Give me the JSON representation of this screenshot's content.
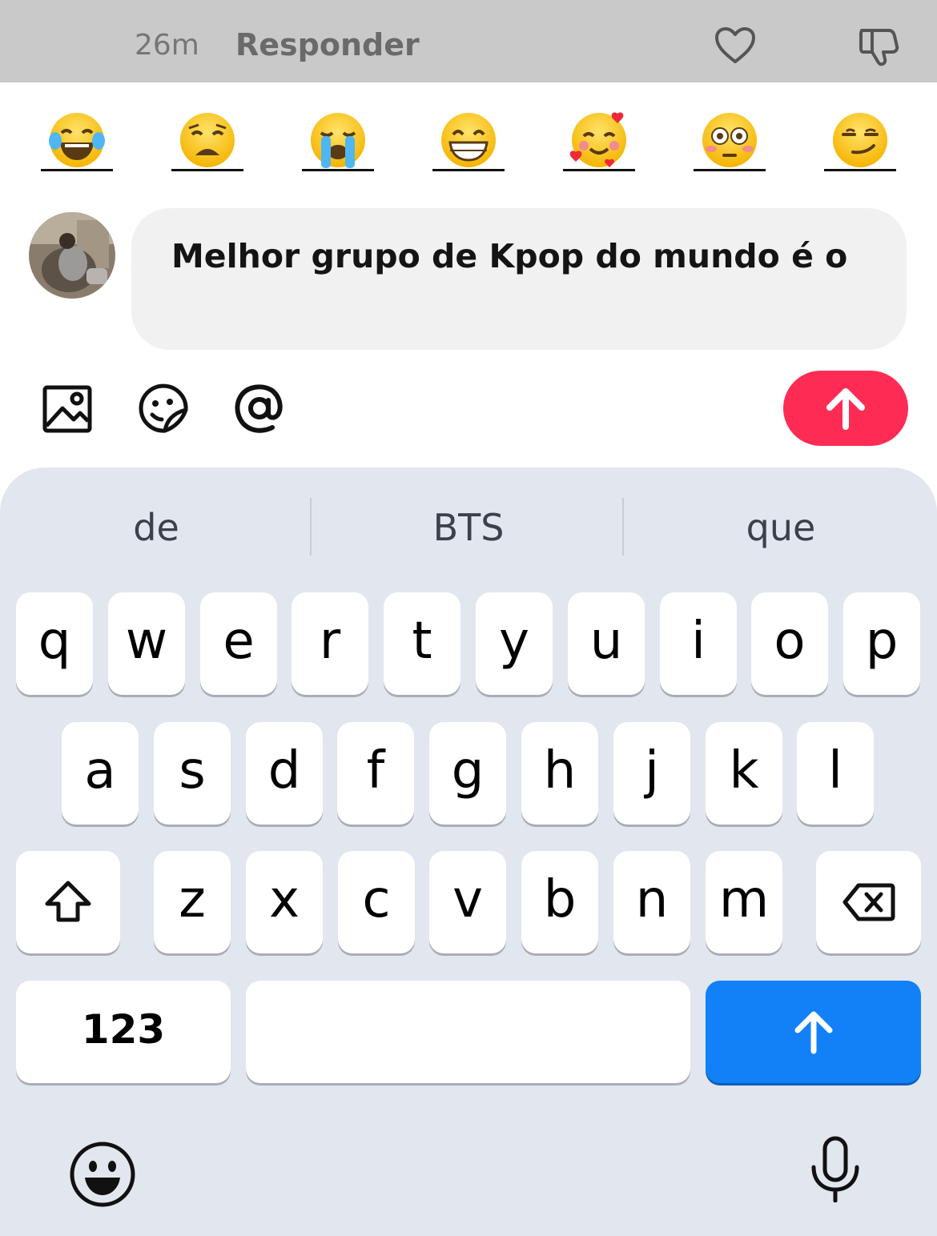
{
  "header": {
    "time": "26m",
    "reply_label": "Responder",
    "like_icon": "heart-outline-icon",
    "dislike_icon": "thumbs-down-icon"
  },
  "emoji_bar": [
    {
      "name": "face-with-tears-of-joy",
      "char": "😂"
    },
    {
      "name": "weary-face",
      "char": "😩"
    },
    {
      "name": "loudly-crying-face",
      "char": "😭"
    },
    {
      "name": "beaming-face",
      "char": "😁"
    },
    {
      "name": "smiling-face-with-hearts",
      "char": "🥰"
    },
    {
      "name": "flushed-face",
      "char": "😳"
    },
    {
      "name": "smirking-face",
      "char": "😏"
    }
  ],
  "composer": {
    "text": "Melhor grupo de Kpop do mundo é o",
    "tools": [
      "image-icon",
      "sticker-icon",
      "mention-icon"
    ],
    "send_color": "#fe2c55"
  },
  "keyboard": {
    "suggestions": [
      "de",
      "BTS",
      "que"
    ],
    "row1": [
      "q",
      "w",
      "e",
      "r",
      "t",
      "y",
      "u",
      "i",
      "o",
      "p"
    ],
    "row2": [
      "a",
      "s",
      "d",
      "f",
      "g",
      "h",
      "j",
      "k",
      "l"
    ],
    "row3": [
      "z",
      "x",
      "c",
      "v",
      "b",
      "n",
      "m"
    ],
    "numbers_label": "123",
    "return_color": "#1281f8"
  }
}
